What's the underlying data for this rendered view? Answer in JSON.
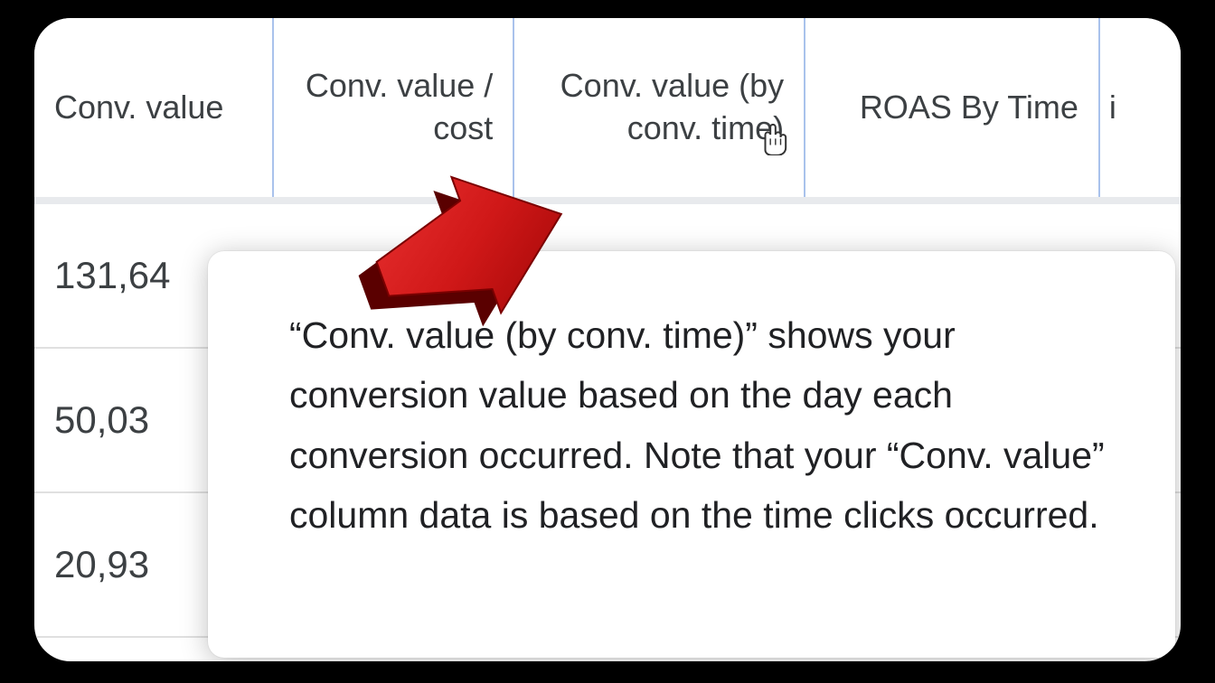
{
  "headers": {
    "conv_value": "Conv. value",
    "conv_value_cost": "Conv. value / cost",
    "conv_value_by_time": "Conv. value (by conv. time)",
    "roas_by_time": "ROAS By Time",
    "last_fragment": "i"
  },
  "rows": {
    "r0": "131,64",
    "r1": "50,03",
    "r2": "20,93"
  },
  "tooltip": {
    "text": "“Conv. value (by conv. time)” shows your conversion value based on the day each conversion occurred. Note that your “Conv. value” column data is based on the time clicks occurred."
  },
  "icons": {
    "arrow": "red-arrow",
    "cursor": "pointer-cursor"
  }
}
